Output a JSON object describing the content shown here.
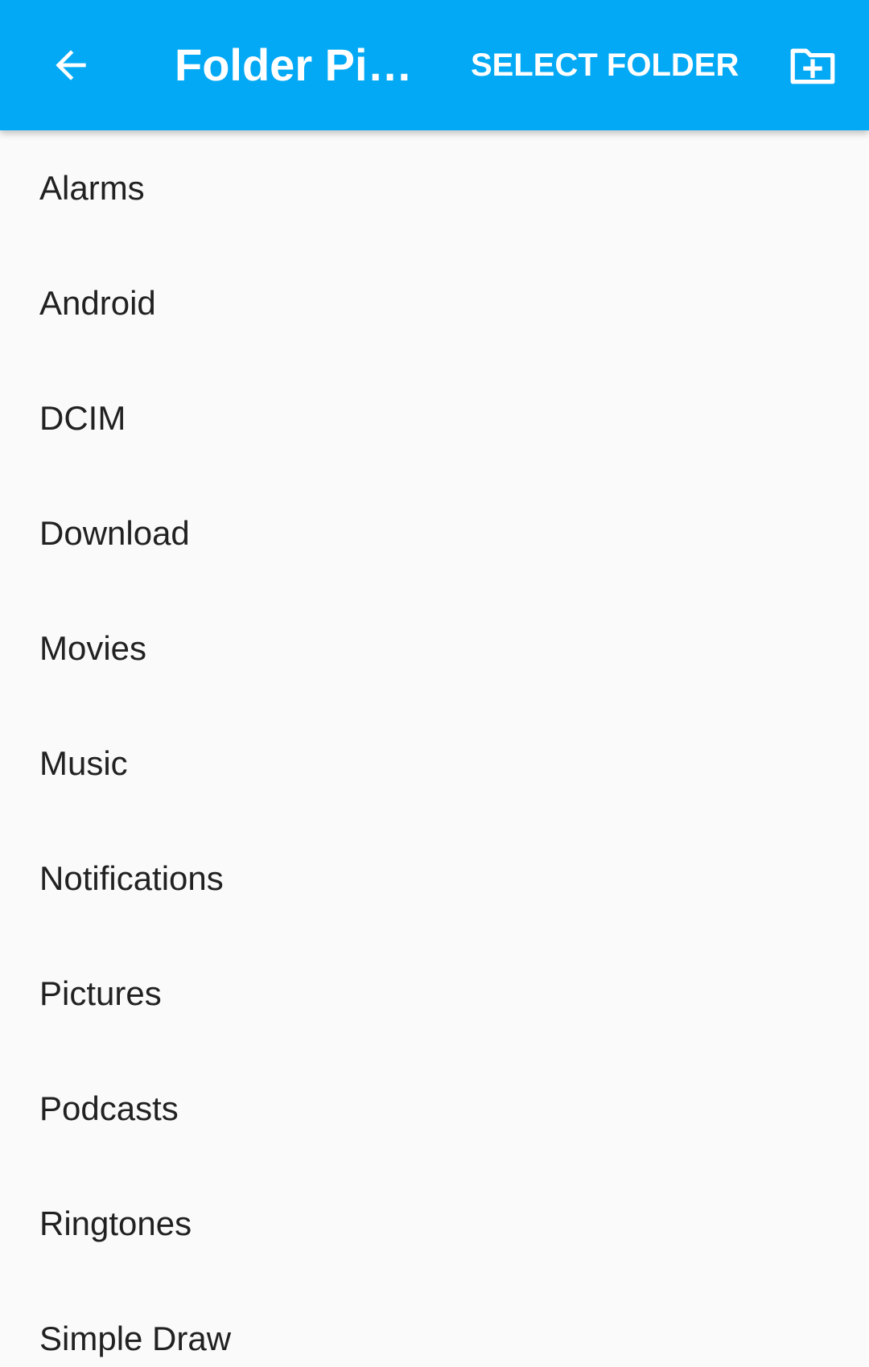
{
  "toolbar": {
    "back_icon": "arrow-back-icon",
    "title": "Folder Pi…",
    "select_label": "SELECT FOLDER",
    "new_folder_icon": "create-new-folder-icon"
  },
  "folders": [
    {
      "name": "Alarms"
    },
    {
      "name": "Android"
    },
    {
      "name": "DCIM"
    },
    {
      "name": "Download"
    },
    {
      "name": "Movies"
    },
    {
      "name": "Music"
    },
    {
      "name": "Notifications"
    },
    {
      "name": "Pictures"
    },
    {
      "name": "Podcasts"
    },
    {
      "name": "Ringtones"
    },
    {
      "name": "Simple Draw"
    }
  ],
  "colors": {
    "appbar": "#03a9f4",
    "appbar_text": "#ffffff",
    "background": "#fafafa",
    "item_text": "#212121"
  }
}
